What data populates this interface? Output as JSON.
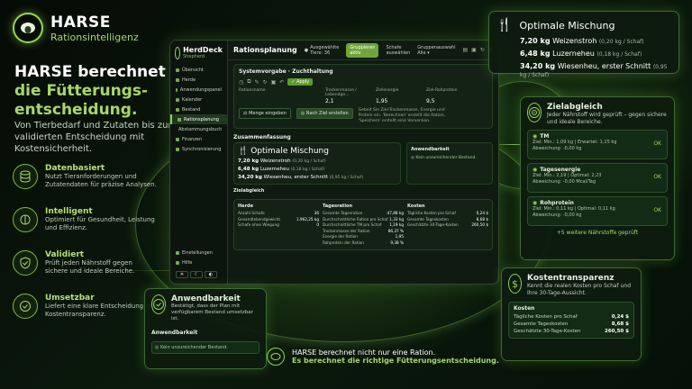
{
  "brand": {
    "name": "HARSE",
    "tagline": "Rationsintelligenz"
  },
  "hero": {
    "line1": "HARSE berechnet",
    "line2": "die Fütterungs-",
    "line3": "entscheidung.",
    "sub": "Von Tierbedarf und Zutaten bis zur validierten Entscheidung mit Kostensicherheit."
  },
  "features": [
    {
      "icon": "database-icon",
      "title": "Datenbasiert",
      "desc": "Nutzt Tieranforderungen und Zutatendaten für präzise Analysen."
    },
    {
      "icon": "brain-icon",
      "title": "Intelligent",
      "desc": "Optimiert für Gesundheit, Leistung und Effizienz."
    },
    {
      "icon": "shield-check-icon",
      "title": "Validiert",
      "desc": "Prüft jeden Nährstoff gegen sichere und ideale Bereiche."
    },
    {
      "icon": "check-circle-icon",
      "title": "Umsetzbar",
      "desc": "Liefert eine klare Entscheidung mit Kostentransparenz."
    }
  ],
  "app": {
    "logo": "HerdDeck",
    "logo_sub": "Shepherd",
    "nav": [
      "Übersicht",
      "Herde",
      "Anwendungspanel",
      "Kalender",
      "Bestand",
      "Rationsplanung",
      "Abstammungsbuch",
      "Finanzen",
      "Synchronisierung"
    ],
    "active_nav": 5,
    "nav_bottom": [
      "Einstellungen",
      "Hilfe"
    ],
    "topbar": {
      "title": "Rationsplanung",
      "animals": "Ausgewählte Tiere: 36",
      "group_pill": "Gruppieren",
      "group_pill_sub": "aktiv",
      "sheep": "Schafe",
      "sheep_sub": "auswählen",
      "group_label": "Gruppenauswahl",
      "group_value": "Alle"
    },
    "goal_panel": {
      "title": "Systemvorgabe · Zuchthaltung",
      "apply": "Apply",
      "cols": [
        "Rationsname",
        "Trockenmasse / Lebendge...",
        "Zielenergie",
        "Ziel-Rohprotein"
      ],
      "vals": [
        "",
        "2,1",
        "1,95",
        "9,5"
      ],
      "btn_quantity": "Menge eingeben",
      "btn_goal": "Nach Ziel erstellen",
      "note": "Gebeit Sie Ziel-Trockenmasse, Energie und Protein ein. 'Berechnen' erstellt die Ration, 'Speichern' erstellt eine Vorversion."
    },
    "summary": {
      "section": "Zusammenfassung",
      "title": "Optimale Mischung",
      "rows": [
        {
          "qty": "7,20 kg",
          "name": "Weizenstroh",
          "meta": "(0,20 kg / Schaf)"
        },
        {
          "qty": "6,48 kg",
          "name": "Luzerneheu",
          "meta": "(0,18 kg / Schaf)"
        },
        {
          "qty": "34,20 kg",
          "name": "Wiesenheu, erster Schnitt",
          "meta": "(0,95 kg / Schaf)"
        }
      ],
      "avail_title": "Anwendbarkeit",
      "avail_ok": "Kein unzureichender Bestand."
    },
    "ziel": {
      "section": "Zielabgleich",
      "cols": [
        {
          "title": "Herde",
          "rows": [
            [
              "Anzahl Schafe",
              "36"
            ],
            [
              "Gesamtlebendgewicht",
              "1.962,25 kg"
            ],
            [
              "Schafe ohne Wiegung",
              "0"
            ]
          ]
        },
        {
          "title": "Tagesration",
          "rows": [
            [
              "Gesamte Tagesration",
              "47,88 kg"
            ],
            [
              "Durchschnittliche Ration pro Schaf",
              "1,33 kg"
            ],
            [
              "Durchschnittliche TM pro Schaf",
              "1,19 kg"
            ],
            [
              "Trockenmasse der Ration",
              "86,37 %"
            ],
            [
              "Energie der Ration",
              "1,95"
            ],
            [
              "Rohprotein der Ration",
              "9,38 %"
            ]
          ]
        },
        {
          "title": "Kosten",
          "rows": [
            [
              "Tägliche Kosten pro Schaf",
              "0,24 $"
            ],
            [
              "Gesamte Tageskosten",
              "8,68 $"
            ],
            [
              "Geschätzte 30-Tage-Kosten",
              "260,50 $"
            ]
          ]
        }
      ]
    }
  },
  "mix_card": {
    "title": "Optimale Mischung",
    "rows": [
      {
        "qty": "7,20 kg",
        "name": "Weizenstroh",
        "meta": "(0,20 kg / Schaf)"
      },
      {
        "qty": "6,48 kg",
        "name": "Luzerneheu",
        "meta": "(0,18 kg / Schaf)"
      },
      {
        "qty": "34,20 kg",
        "name": "Wiesenheu, erster Schnitt",
        "meta": "(0,95 kg / Schaf)"
      }
    ]
  },
  "ziel_card": {
    "title": "Zielabgleich",
    "desc": "Jeder Nährstoff wird geprüft – gegen sichere und ideale Bereiche.",
    "items": [
      {
        "name": "TM",
        "line1": "Ziel: Min.: 1,09 kg | Erwartet: 1,15 kg",
        "line2": "Abweichung: -0,00 kg",
        "status": "OK"
      },
      {
        "name": "Tagesenergie",
        "line1": "Ziel: Min.: 2,19 | Optimal: 2,23",
        "line2": "Abweichung: -0,00 Mcal/Tag",
        "status": "OK"
      },
      {
        "name": "Rohprotein",
        "line1": "Ziel: Min.: 0,11 kg | Optimal: 0,11 kg",
        "line2": "Abweichung: -0,00 kg",
        "status": "OK"
      }
    ],
    "more": "+5 weitere Nährstoffe geprüft"
  },
  "cost_card": {
    "title": "Kostentransparenz",
    "desc": "Kennt die realen Kosten pro Schaf und Ihre 30-Tage-Aussicht.",
    "box_title": "Kosten",
    "rows": [
      {
        "label": "Tägliche Kosten pro Schaf",
        "value": "0,24 $"
      },
      {
        "label": "Gesamte Tageskosten",
        "value": "8,68 $"
      },
      {
        "label": "Geschätzte 30-Tage-Kosten",
        "value": "260,50 $"
      }
    ]
  },
  "avail_card": {
    "title": "Anwendbarkeit",
    "desc": "Bestätigt, dass der Plan mit verfügbarem Bestand umsetzbar ist.",
    "sub": "Anwendbarkeit",
    "ok": "Kein unzureichender Bestand."
  },
  "bottom": {
    "line1": "HARSE berechnet nicht nur eine Ration.",
    "line2": "Es berechnet die richtige Fütterungsentscheidung."
  }
}
